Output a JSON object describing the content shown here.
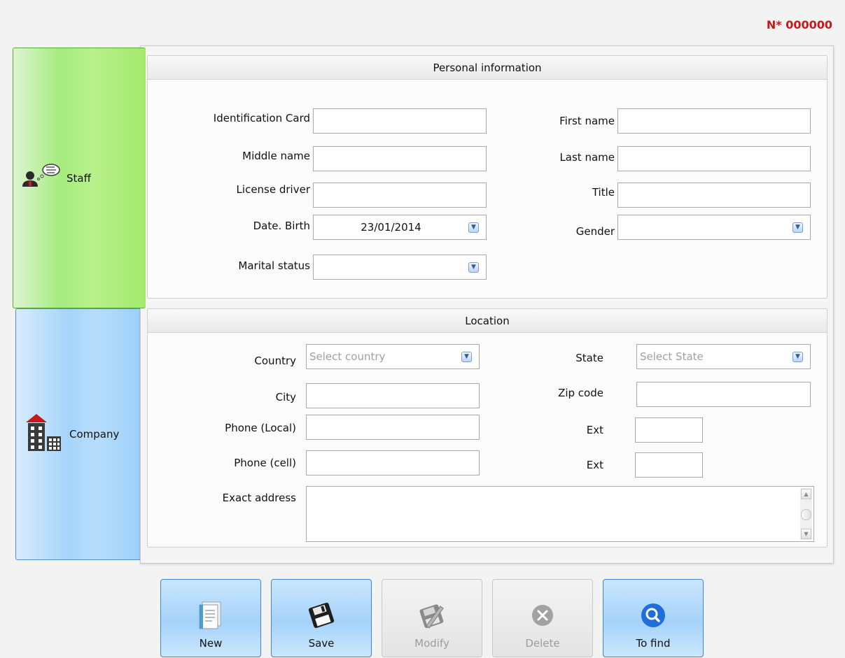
{
  "record_number": "N* 000000",
  "tabs": {
    "staff": "Staff",
    "company": "Company"
  },
  "personal": {
    "title": "Personal information",
    "identification_card_label": "Identification Card",
    "middle_name_label": "Middle name",
    "license_driver_label": "License driver",
    "date_birth_label": "Date. Birth",
    "date_birth_value": "23/01/2014",
    "marital_status_label": "Marital status",
    "first_name_label": "First name",
    "last_name_label": "Last name",
    "title_label": "Title",
    "gender_label": "Gender"
  },
  "location": {
    "title": "Location",
    "country_label": "Country",
    "country_placeholder": "Select country",
    "state_label": "State",
    "state_placeholder": "Select State",
    "city_label": "City",
    "zip_label": "Zip code",
    "phone_local_label": "Phone (Local)",
    "ext_label_1": "Ext",
    "phone_cell_label": "Phone (cell)",
    "ext_label_2": "Ext",
    "address_label": "Exact address"
  },
  "buttons": {
    "new": "New",
    "save": "Save",
    "modify": "Modify",
    "delete": "Delete",
    "find": "To find"
  },
  "colors": {
    "record_number": "#c81818",
    "staff_tab": "#a6ec80",
    "company_tab": "#a6d4fb",
    "button_active": "#a5d2fa"
  }
}
